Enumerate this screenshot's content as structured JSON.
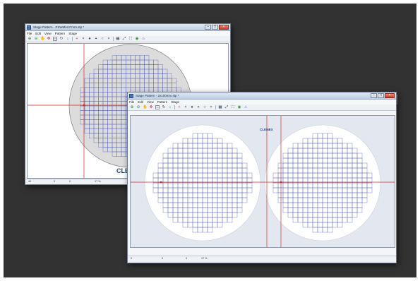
{
  "back_window": {
    "title": "Stage Pattern - PSWafer47mm.stp *",
    "menu": [
      "File",
      "Edit",
      "View",
      "Pattern",
      "Stage"
    ],
    "toolbar_icons": [
      "zoom-in-icon",
      "zoom-out-icon",
      "pan-icon",
      "move-icon",
      "select-icon",
      "rotate-icon",
      "step-icon",
      "add-point-icon",
      "delete-icon",
      "circle-icon",
      "target-icon",
      "ring-icon",
      "clear-icon",
      "grid-icon",
      "fit-icon",
      "expand-icon",
      "view-icon",
      "home-icon"
    ],
    "brand": "CLEM",
    "status": [
      "40",
      "0",
      "0",
      "17 %"
    ]
  },
  "front_window": {
    "title": "Stage Pattern - 2x100mm.stp *",
    "menu": [
      "File",
      "Edit",
      "View",
      "Pattern",
      "Stage"
    ],
    "toolbar_icons": [
      "zoom-in-icon",
      "zoom-out-icon",
      "pan-icon",
      "move-icon",
      "select-icon",
      "rotate-icon",
      "step-icon",
      "add-point-icon",
      "delete-icon",
      "circle-icon",
      "target-icon",
      "ring-icon",
      "clear-icon",
      "grid-icon",
      "fit-icon",
      "expand-icon",
      "view-icon",
      "home-icon"
    ],
    "brand": "CLEMEX",
    "status": [
      "0",
      "0",
      "0",
      "17 %"
    ]
  },
  "colors": {
    "desktop": "#323232",
    "wafer_fill_back": "#dcdcdc",
    "wafer_fill_front": "#ffffff",
    "canvas_bg_front": "#e3e8f0",
    "grid_line": "#5a67b8",
    "crosshair": "#d42a2a",
    "brand": "#27457a"
  }
}
